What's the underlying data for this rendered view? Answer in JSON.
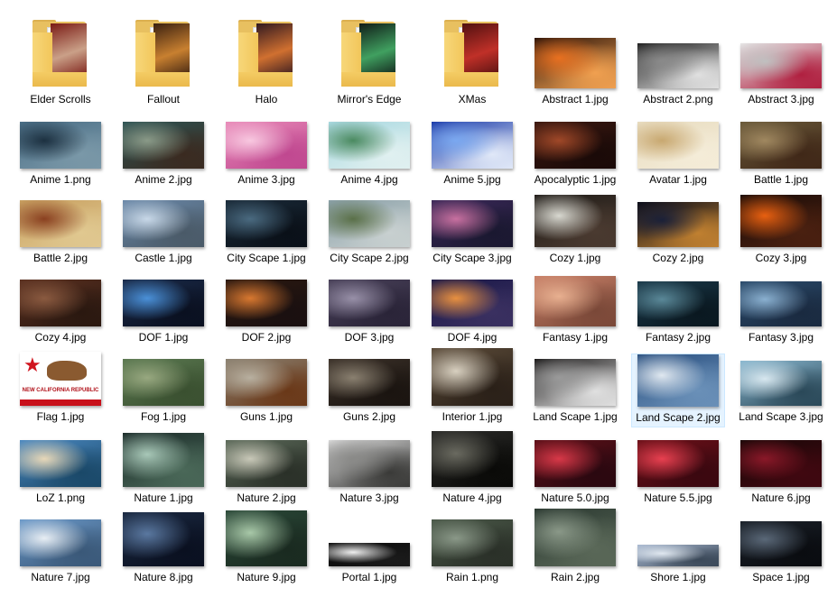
{
  "explorer": {
    "selected_index": 38,
    "items": [
      {
        "label": "Elder Scrolls",
        "type": "folder",
        "colors": [
          "#7a1a14",
          "#caa088"
        ]
      },
      {
        "label": "Fallout",
        "type": "folder",
        "colors": [
          "#3a2010",
          "#c88030"
        ]
      },
      {
        "label": "Halo",
        "type": "folder",
        "colors": [
          "#301820",
          "#d07030"
        ]
      },
      {
        "label": "Mirror's Edge",
        "type": "folder",
        "colors": [
          "#101c18",
          "#40a060"
        ]
      },
      {
        "label": "XMas",
        "type": "folder",
        "colors": [
          "#501010",
          "#c03028"
        ]
      },
      {
        "label": "Abstract 1.jpg",
        "type": "image",
        "colors": [
          "#2a1208",
          "#e87020",
          "#f0a050"
        ]
      },
      {
        "label": "Abstract 2.png",
        "type": "image",
        "colors": [
          "#1e1e1e",
          "#8a8a8a",
          "#e0e0e0"
        ]
      },
      {
        "label": "Abstract 3.jpg",
        "type": "image",
        "colors": [
          "#e6e6e6",
          "#c0c0c0",
          "#b02040"
        ]
      },
      {
        "label": "Anime 1.png",
        "type": "image",
        "colors": [
          "#4a6e86",
          "#1c3040",
          "#7a98a8"
        ]
      },
      {
        "label": "Anime 2.jpg",
        "type": "image",
        "colors": [
          "#2e5454",
          "#8a9a88",
          "#3a2a20"
        ]
      },
      {
        "label": "Anime 3.jpg",
        "type": "image",
        "colors": [
          "#e88ab8",
          "#f8c8e0",
          "#c04890"
        ]
      },
      {
        "label": "Anime 4.jpg",
        "type": "image",
        "colors": [
          "#a8d8e0",
          "#4a8a60",
          "#e0f0f0"
        ]
      },
      {
        "label": "Anime 5.jpg",
        "type": "image",
        "colors": [
          "#1a3aa8",
          "#7aa8f0",
          "#e0e8f8"
        ]
      },
      {
        "label": "Apocalyptic 1.jpg",
        "type": "image",
        "colors": [
          "#3a1810",
          "#a04828",
          "#1a0a08"
        ]
      },
      {
        "label": "Avatar 1.jpg",
        "type": "image",
        "colors": [
          "#e8dcc0",
          "#c8a870",
          "#f4ecd8"
        ]
      },
      {
        "label": "Battle 1.jpg",
        "type": "image",
        "colors": [
          "#6a5a3a",
          "#a08860",
          "#402818"
        ]
      },
      {
        "label": "Battle 2.jpg",
        "type": "image",
        "colors": [
          "#c8a060",
          "#8a4020",
          "#e0c890"
        ]
      },
      {
        "label": "Castle 1.jpg",
        "type": "image",
        "colors": [
          "#6a88a8",
          "#c8d8e8",
          "#4a5a68"
        ]
      },
      {
        "label": "City Scape 1.jpg",
        "type": "image",
        "colors": [
          "#1a2a38",
          "#4a6a80",
          "#0a1018"
        ]
      },
      {
        "label": "City Scape 2.jpg",
        "type": "image",
        "colors": [
          "#8aa0a8",
          "#5a7048",
          "#c8d0d0"
        ]
      },
      {
        "label": "City Scape 3.jpg",
        "type": "image",
        "colors": [
          "#3a2858",
          "#c870a0",
          "#1a1830"
        ]
      },
      {
        "label": "Cozy 1.jpg",
        "type": "image",
        "colors": [
          "#201c18",
          "#d8d8d0",
          "#4a3a30"
        ]
      },
      {
        "label": "Cozy 2.jpg",
        "type": "image",
        "colors": [
          "#0a0c18",
          "#1a2038",
          "#c08030"
        ]
      },
      {
        "label": "Cozy 3.jpg",
        "type": "image",
        "colors": [
          "#1a0c08",
          "#e86010",
          "#4a2010"
        ]
      },
      {
        "label": "Cozy 4.jpg",
        "type": "image",
        "colors": [
          "#5a3020",
          "#8a5a40",
          "#2a1810"
        ]
      },
      {
        "label": "DOF 1.jpg",
        "type": "image",
        "colors": [
          "#1a2a48",
          "#4a90d8",
          "#0a1020"
        ]
      },
      {
        "label": "DOF 2.jpg",
        "type": "image",
        "colors": [
          "#2a1810",
          "#d87830",
          "#1a1010"
        ]
      },
      {
        "label": "DOF 3.jpg",
        "type": "image",
        "colors": [
          "#484058",
          "#9890a8",
          "#2a2438"
        ]
      },
      {
        "label": "DOF 4.jpg",
        "type": "image",
        "colors": [
          "#1a1848",
          "#e89040",
          "#3a3060"
        ]
      },
      {
        "label": "Fantasy 1.jpg",
        "type": "image",
        "colors": [
          "#c88068",
          "#e8b090",
          "#7a4838"
        ]
      },
      {
        "label": "Fantasy 2.jpg",
        "type": "image",
        "colors": [
          "#1a3848",
          "#5a8898",
          "#0a1820"
        ]
      },
      {
        "label": "Fantasy 3.jpg",
        "type": "image",
        "colors": [
          "#2a4a6a",
          "#8ab0d0",
          "#1a2a40"
        ]
      },
      {
        "label": "Flag 1.jpg",
        "type": "flag",
        "colors": [
          "#ffffff",
          "#d0141e",
          "#8a5a30"
        ]
      },
      {
        "label": "Fog 1.jpg",
        "type": "image",
        "colors": [
          "#5a7850",
          "#98a880",
          "#3a5030"
        ]
      },
      {
        "label": "Guns 1.jpg",
        "type": "image",
        "colors": [
          "#8a8070",
          "#b8b0a0",
          "#6a3818"
        ]
      },
      {
        "label": "Guns 2.jpg",
        "type": "image",
        "colors": [
          "#3a3028",
          "#8a8070",
          "#1a1410"
        ]
      },
      {
        "label": "Interior 1.jpg",
        "type": "image",
        "colors": [
          "#5a4a38",
          "#d8d0c0",
          "#2a2018"
        ]
      },
      {
        "label": "Land Scape 1.jpg",
        "type": "image",
        "colors": [
          "#1a1818",
          "#9a9a9a",
          "#e0e0e0"
        ]
      },
      {
        "label": "Land Scape 2.jpg",
        "type": "image",
        "colors": [
          "#2a5080",
          "#e0e8f0",
          "#6a90b8"
        ]
      },
      {
        "label": "Land Scape 3.jpg",
        "type": "image",
        "colors": [
          "#8ab8d0",
          "#d8e8f0",
          "#2a4858"
        ]
      },
      {
        "label": "LoZ 1.png",
        "type": "image",
        "colors": [
          "#4a88c0",
          "#e8d8b8",
          "#1a4868"
        ]
      },
      {
        "label": "Nature 1.jpg",
        "type": "image",
        "colors": [
          "#1a2a28",
          "#a8c8b8",
          "#4a6858"
        ]
      },
      {
        "label": "Nature 2.jpg",
        "type": "image",
        "colors": [
          "#5a6858",
          "#c8c8b8",
          "#2a3028"
        ]
      },
      {
        "label": "Nature 3.jpg",
        "type": "image",
        "colors": [
          "#d8d8d8",
          "#8a8a88",
          "#3a3a38"
        ]
      },
      {
        "label": "Nature 4.jpg",
        "type": "image",
        "colors": [
          "#2a2a28",
          "#6a6a60",
          "#0a0a08"
        ]
      },
      {
        "label": "Nature 5.0.jpg",
        "type": "image",
        "colors": [
          "#5a1018",
          "#d83848",
          "#2a0810"
        ]
      },
      {
        "label": "Nature 5.5.jpg",
        "type": "image",
        "colors": [
          "#6a1018",
          "#e84050",
          "#3a0810"
        ]
      },
      {
        "label": "Nature 6.jpg",
        "type": "image",
        "colors": [
          "#1a0808",
          "#8a1828",
          "#400810"
        ]
      },
      {
        "label": "Nature 7.jpg",
        "type": "image",
        "colors": [
          "#6a98c8",
          "#e8eef4",
          "#3a5878"
        ]
      },
      {
        "label": "Nature 8.jpg",
        "type": "image",
        "colors": [
          "#1a2840",
          "#5a78a0",
          "#0a1020"
        ]
      },
      {
        "label": "Nature 9.jpg",
        "type": "image",
        "colors": [
          "#2a4838",
          "#a8c8a8",
          "#1a2a20"
        ]
      },
      {
        "label": "Portal 1.jpg",
        "type": "image",
        "colors": [
          "#080808",
          "#f0f0f0",
          "#1a1a1a"
        ]
      },
      {
        "label": "Rain 1.png",
        "type": "image",
        "colors": [
          "#4a5848",
          "#8a9888",
          "#2a3028"
        ]
      },
      {
        "label": "Rain 2.jpg",
        "type": "image",
        "colors": [
          "#2a3830",
          "#8a9888",
          "#5a6858"
        ]
      },
      {
        "label": "Shore 1.jpg",
        "type": "image",
        "colors": [
          "#a8b8d0",
          "#e0e8f0",
          "#3a4858"
        ]
      },
      {
        "label": "Space 1.jpg",
        "type": "image",
        "colors": [
          "#1a2028",
          "#5a6878",
          "#0a0c10"
        ]
      }
    ]
  }
}
